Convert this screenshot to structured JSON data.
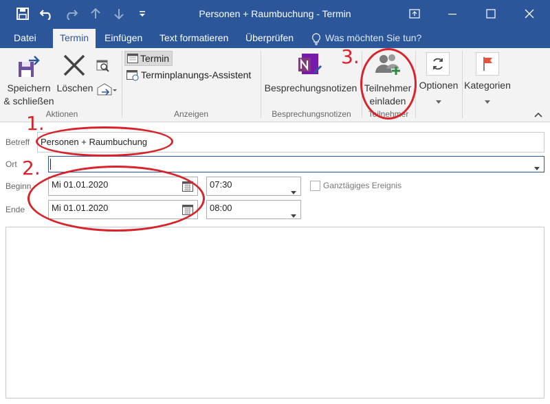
{
  "window": {
    "title": "Personen + Raumbuchung - Termin"
  },
  "menu": {
    "items": [
      "Datei",
      "Termin",
      "Einfügen",
      "Text formatieren",
      "Überprüfen"
    ],
    "search_hint": "Was möchten Sie tun?"
  },
  "ribbon": {
    "save_line1": "Speichern",
    "save_line2": "& schließen",
    "delete": "Löschen",
    "group_actions": "Aktionen",
    "view_termin": "Termin",
    "view_assistant": "Terminplanungs-Assistent",
    "group_show": "Anzeigen",
    "notes": "Besprechungsnotizen",
    "group_notes": "Besprechungsnotizen",
    "invite_line1": "Teilnehmer",
    "invite_line2": "einladen",
    "group_attendees": "Teilnehmer",
    "options": "Optionen",
    "categories": "Kategorien"
  },
  "form": {
    "subject_label": "Betreff",
    "subject_value": "Personen + Raumbuchung",
    "location_label": "Ort",
    "location_value": "",
    "start_label": "Beginn",
    "start_date": "Mi 01.01.2020",
    "start_time": "07:30",
    "allday_label": "Ganztägiges Ereignis",
    "end_label": "Ende",
    "end_date": "Mi 01.01.2020",
    "end_time": "08:00"
  },
  "annotations": {
    "step1": "1.",
    "step2": "2.",
    "step3": "3."
  },
  "colors": {
    "titlebar": "#2b579a",
    "annotation": "#d8232a"
  }
}
